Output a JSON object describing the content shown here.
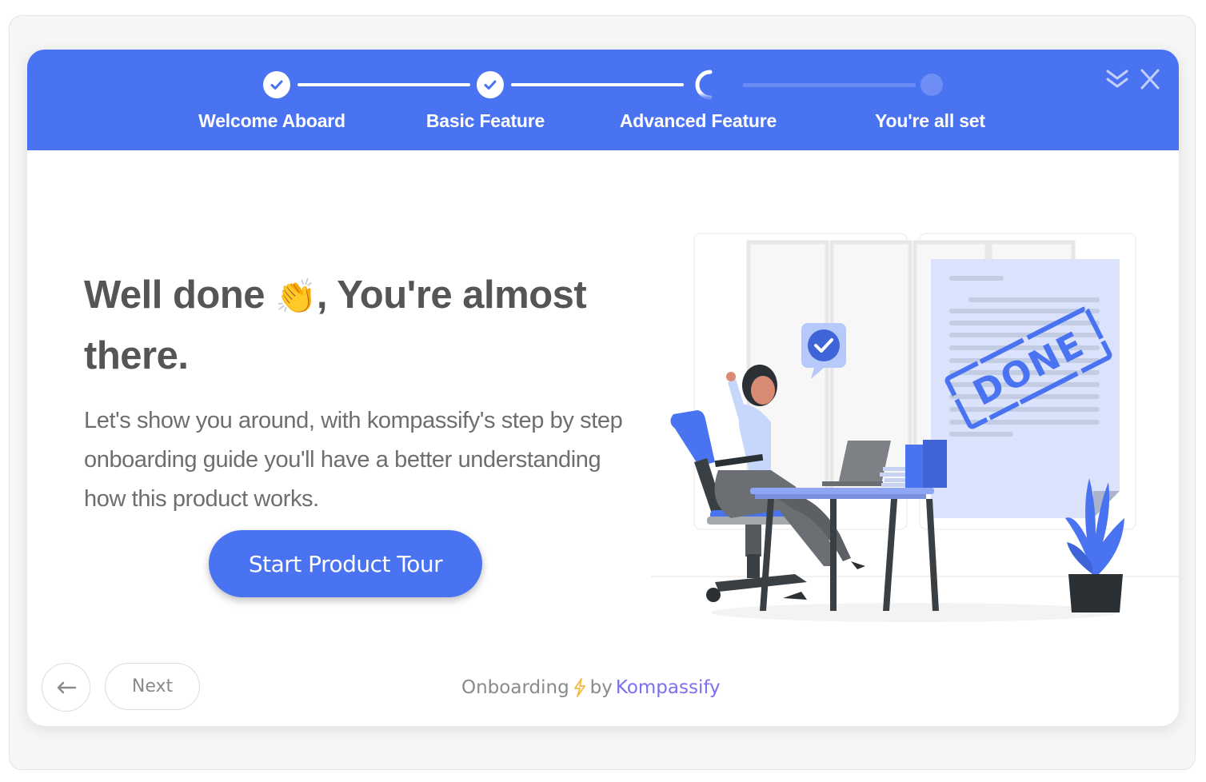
{
  "stepper": {
    "steps": [
      {
        "label": "Welcome Aboard",
        "state": "completed"
      },
      {
        "label": "Basic Feature",
        "state": "completed"
      },
      {
        "label": "Advanced Feature",
        "state": "in-progress"
      },
      {
        "label": "You're all set",
        "state": "upcoming"
      }
    ]
  },
  "header": {
    "minimize_icon": "double-chevron-down-icon",
    "close_icon": "close-icon"
  },
  "main": {
    "title_part1": "Well done ",
    "title_emoji": "👏",
    "title_part2": ", You're almost there.",
    "description": "Let's show you around, with kompassify's step by step onboarding guide you'll have a better understanding how this product works.",
    "cta_label": "Start Product Tour",
    "illustration": {
      "stamp_text": "DONE",
      "description": "woman celebrating at desk with laptop, DONE stamp document, plant"
    }
  },
  "footer": {
    "back_icon": "arrow-left-icon",
    "next_label": "Next",
    "powered_prefix": "Onboarding",
    "powered_icon": "lightning-bolt-icon",
    "powered_by": "by",
    "brand": "Kompassify"
  },
  "colors": {
    "primary": "#4a73f2",
    "brand_text": "#7b6ff0",
    "heading": "#555555",
    "body_text": "#6e6e6e",
    "lightning": "#f5b942"
  }
}
